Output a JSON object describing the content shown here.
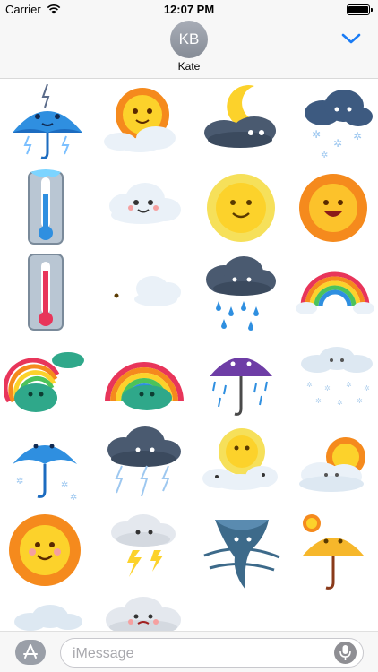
{
  "status_bar": {
    "carrier": "Carrier",
    "time": "12:07 PM"
  },
  "header": {
    "avatar_initials": "KB",
    "contact_name": "Kate"
  },
  "sticker_grid": {
    "rows": [
      [
        "thunderstorm-umbrella-sticker",
        "sun-behind-cloud-sticker",
        "moon-over-cloud-sticker",
        "snow-cloud-sticker"
      ],
      [
        "cold-thermometer-sticker",
        "smiling-cloud-sticker",
        "yellow-sun-sticker",
        "orange-sun-sticker"
      ],
      [
        "hot-thermometer-sticker",
        "crescent-moon-cloud-sticker",
        "rain-cloud-sticker",
        "small-rainbow-sticker"
      ],
      [
        "rainbow-cloud-sticker",
        "rainbow-arch-sticker",
        "purple-umbrella-rain-sticker",
        "snowy-clouds-sticker"
      ],
      [
        "snowy-umbrella-sticker",
        "lightning-cloud-sticker",
        "sun-clouds-sticker",
        "cloud-sun-sticker"
      ],
      [
        "happy-sun-sticker",
        "thunder-cloud-sticker",
        "tornado-sticker",
        "sun-umbrella-sticker"
      ],
      [
        "partial-cloud-sticker",
        "angry-cloud-sticker"
      ]
    ]
  },
  "input_bar": {
    "placeholder": "iMessage"
  },
  "colors": {
    "accent": "#1a7cf5",
    "sun": "#fcd22b",
    "sun_rays": "#f58a1d",
    "cloud": "#eaf1f8",
    "sky_blue": "#2f8fe0"
  }
}
